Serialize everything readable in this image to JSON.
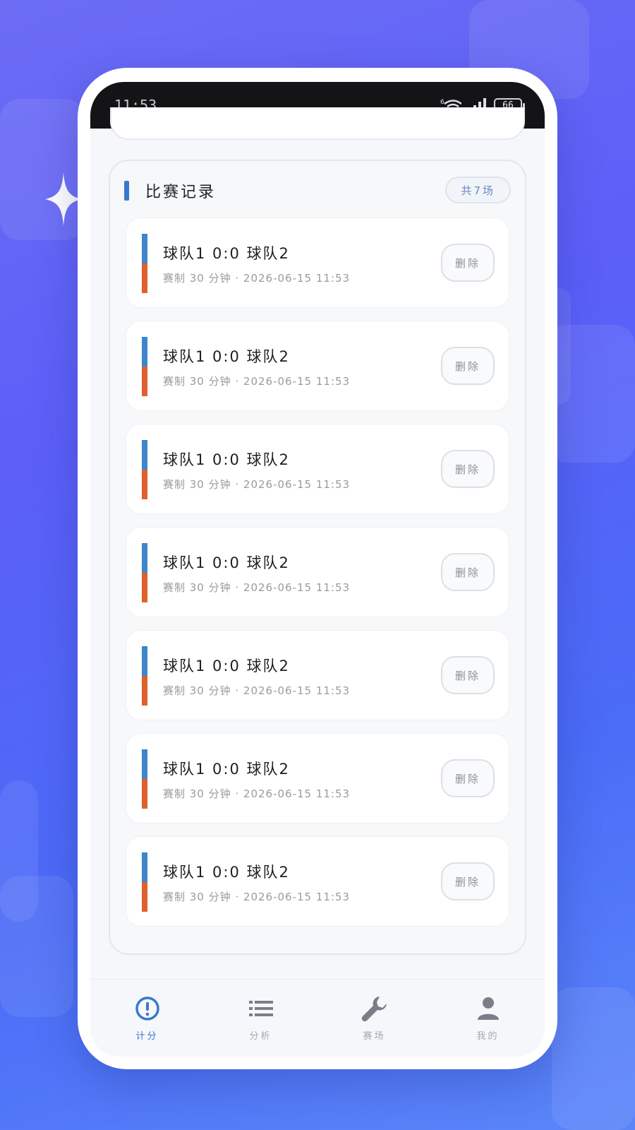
{
  "status_bar": {
    "time": "11:53",
    "network": "6",
    "battery": "66"
  },
  "record_section": {
    "title": "比赛记录",
    "count_label": "共7场",
    "matches": [
      {
        "score": "球队1 0:0 球队2",
        "meta": "赛制 30 分钟 · 2026-06-15 11:53",
        "delete_label": "删除"
      },
      {
        "score": "球队1 0:0 球队2",
        "meta": "赛制 30 分钟 · 2026-06-15 11:53",
        "delete_label": "删除"
      },
      {
        "score": "球队1 0:0 球队2",
        "meta": "赛制 30 分钟 · 2026-06-15 11:53",
        "delete_label": "删除"
      },
      {
        "score": "球队1 0:0 球队2",
        "meta": "赛制 30 分钟 · 2026-06-15 11:53",
        "delete_label": "删除"
      },
      {
        "score": "球队1 0:0 球队2",
        "meta": "赛制 30 分钟 · 2026-06-15 11:53",
        "delete_label": "删除"
      },
      {
        "score": "球队1 0:0 球队2",
        "meta": "赛制 30 分钟 · 2026-06-15 11:53",
        "delete_label": "删除"
      },
      {
        "score": "球队1 0:0 球队2",
        "meta": "赛制 30 分钟 · 2026-06-15 11:53",
        "delete_label": "删除"
      }
    ],
    "team_colors": {
      "home": "#3c86cc",
      "away": "#e0602c"
    }
  },
  "tabbar": {
    "items": [
      {
        "label": "计分",
        "icon": "alert-circle-icon",
        "active": true
      },
      {
        "label": "分析",
        "icon": "list-icon",
        "active": false
      },
      {
        "label": "赛场",
        "icon": "wrench-icon",
        "active": false
      },
      {
        "label": "我的",
        "icon": "person-icon",
        "active": false
      }
    ],
    "active_color": "#3a78d0"
  }
}
